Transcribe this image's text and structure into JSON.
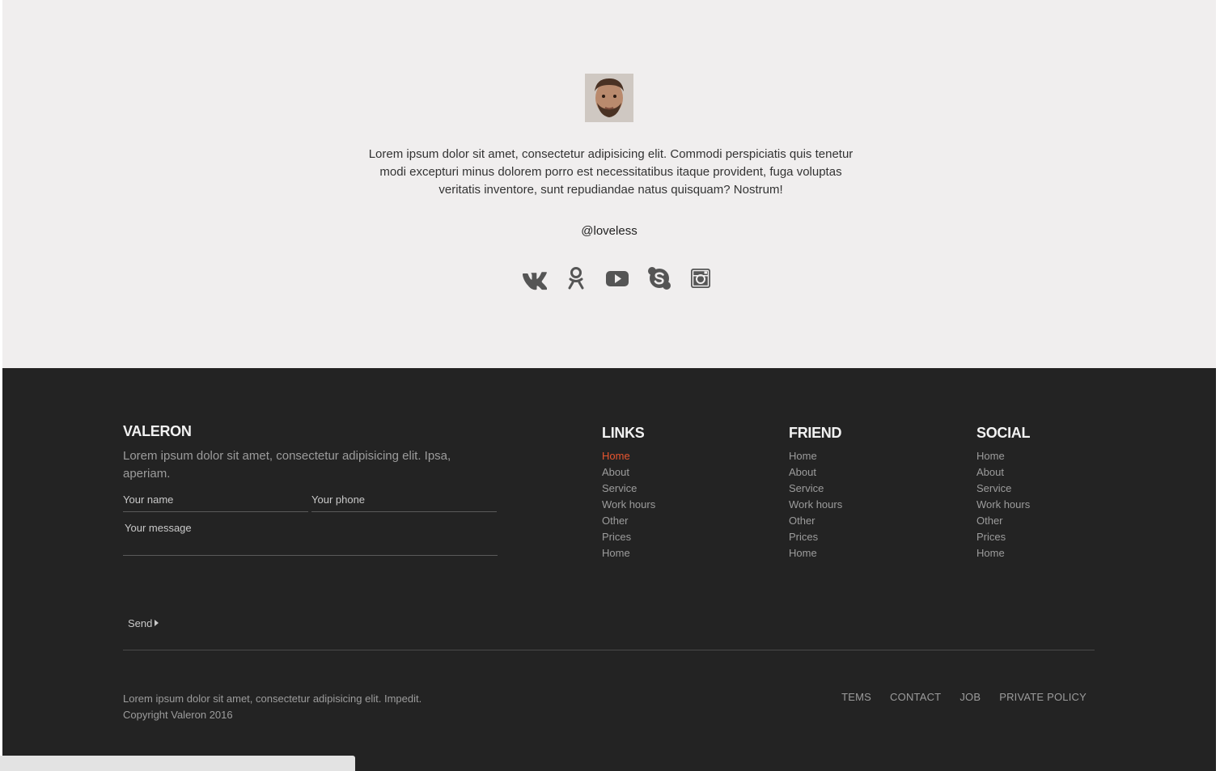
{
  "testimonial": {
    "text": "Lorem ipsum dolor sit amet, consectetur adipisicing elit. Commodi perspiciatis quis tenetur modi excepturi minus dolorem porro est necessitatibus itaque provident, fuga voluptas veritatis inventore, sunt repudiandae natus quisquam? Nostrum!",
    "handle": "@loveless",
    "social_icons": [
      "vk-icon",
      "odnoklassniki-icon",
      "youtube-icon",
      "skype-icon",
      "instagram-icon"
    ]
  },
  "footer": {
    "brand": "VALERON",
    "description": "Lorem ipsum dolor sit amet, consectetur adipisicing elit. Ipsa, aperiam.",
    "form": {
      "name_placeholder": "Your name",
      "phone_placeholder": "Your phone",
      "message_placeholder": "Your message",
      "send_label": "Send"
    },
    "columns": [
      {
        "title": "LINKS",
        "items": [
          "Home",
          "About",
          "Service",
          "Work hours",
          "Other",
          "Prices",
          "Home"
        ]
      },
      {
        "title": "FRIEND",
        "items": [
          "Home",
          "About",
          "Service",
          "Work hours",
          "Other",
          "Prices",
          "Home"
        ]
      },
      {
        "title": "SOCIAL",
        "items": [
          "Home",
          "About",
          "Service",
          "Work hours",
          "Other",
          "Prices",
          "Home"
        ]
      }
    ],
    "bottom_line1": "Lorem ipsum dolor sit amet, consectetur adipisicing elit. Impedit.",
    "bottom_line2": "Copyright Valeron 2016",
    "bottom_links": [
      "TEMS",
      "CONTACT",
      "JOB",
      "PRIVATE POLICY"
    ]
  },
  "colors": {
    "accent": "#e8552f",
    "footer_bg": "#232323",
    "top_bg": "#f0eeee"
  }
}
